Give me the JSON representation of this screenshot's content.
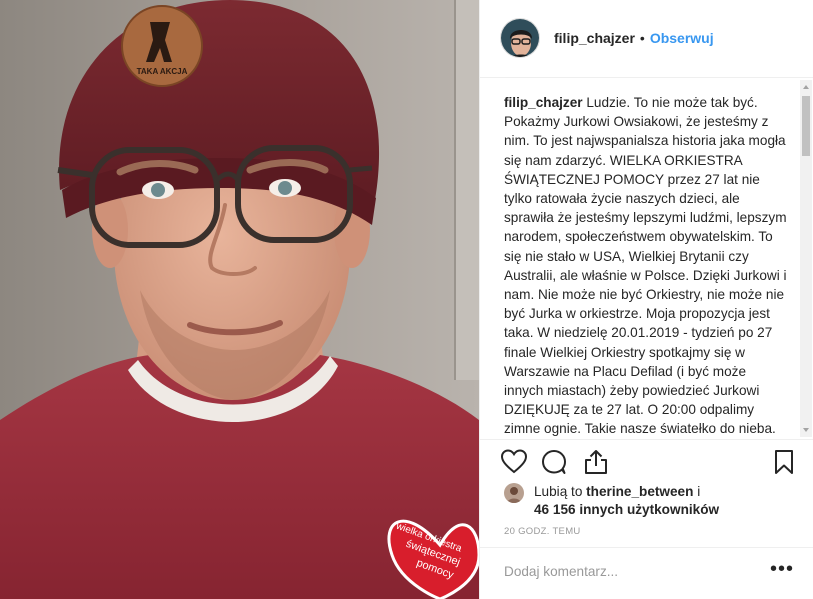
{
  "post": {
    "username": "filip_chajzer",
    "separator": "•",
    "follow_label": "Obserwuj"
  },
  "caption": {
    "username": "filip_chajzer",
    "text": "Ludzie. To nie może tak być. Pokażmy Jurkowi Owsiakowi, że jesteśmy z nim. To jest najwspanialsza historia jaka mogła się nam zdarzyć. WIELKA ORKIESTRA ŚWIĄTECZNEJ POMOCY przez 27 lat nie tylko ratowała życie naszych dzieci, ale sprawiła że jesteśmy lepszymi ludźmi, lepszym narodem, społeczeństwem obywatelskim. To się nie stało w USA, Wielkiej Brytanii czy Australii, ale właśnie w Polsce. Dzięki Jurkowi i nam. Nie może nie być Orkiestry, nie może nie być Jurka w orkiestrze. Moja propozycja jest taka. W niedzielę 20.01.2019 - tydzień po 27 finale Wielkiej Orkiestry spotkajmy się w Warszawie na Placu Defilad (i być może innych miastach) żeby powiedzieć Jurkowi DZIĘKUJĘ za te 27 lat. O 20:00 odpalimy zimne ognie. Takie nasze światełko do nieba."
  },
  "likes": {
    "prefix": "Lubią to",
    "liker": "therine_between",
    "conjunction": "i",
    "others": "46 156 innych użytkowników"
  },
  "timestamp": "20 GODZ. TEMU",
  "comment": {
    "placeholder": "Dodaj komentarz..."
  },
  "more_label": "•••",
  "photo": {
    "hat_patch_text": "TAKA AKCJA",
    "heart_badge_lines": [
      "wielka orkiestra",
      "świątecznej",
      "pomocy"
    ]
  },
  "icons": {
    "like": "heart-icon",
    "comment": "comment-icon",
    "share": "share-icon",
    "save": "bookmark-icon",
    "more": "more-options-icon"
  },
  "colors": {
    "link": "#3897f0",
    "text": "#262626",
    "muted": "#999999",
    "divider": "#efefef",
    "sweater": "#9b2a34",
    "hat": "#6e2128"
  }
}
